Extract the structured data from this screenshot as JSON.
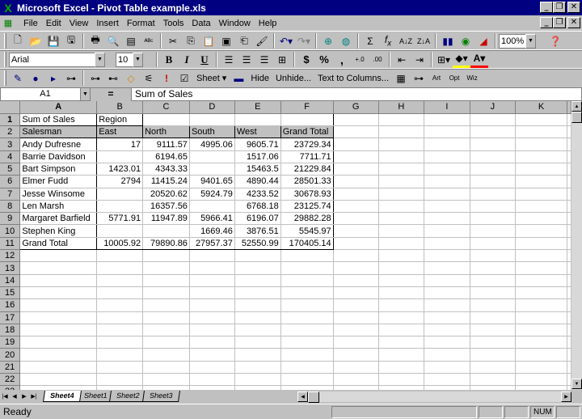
{
  "window": {
    "title": "Microsoft Excel - Pivot Table example.xls",
    "app_icon": "excel-icon"
  },
  "menu": [
    "File",
    "Edit",
    "View",
    "Insert",
    "Format",
    "Tools",
    "Data",
    "Window",
    "Help"
  ],
  "toolbar": {
    "zoom": "100%",
    "font_name": "Arial",
    "font_size": "10",
    "bold_label": "B",
    "italic_label": "I",
    "underline_label": "U",
    "currency_label": "$",
    "percent_label": "%",
    "sum_label": "Σ",
    "function_label": "f",
    "function_sub": "x"
  },
  "toolbar3": {
    "sheet_label": "Sheet",
    "hide_label": "Hide",
    "unhide_label": "Unhide...",
    "text_to_columns_label": "Text to Columns...",
    "art_label": "Art",
    "opt_label": "Opt",
    "wiz_label": "Wiz"
  },
  "formula_bar": {
    "cell_ref": "A1",
    "equals": "=",
    "content": "Sum of Sales"
  },
  "columns": [
    "A",
    "B",
    "C",
    "D",
    "E",
    "F",
    "G",
    "H",
    "I",
    "J",
    "K"
  ],
  "rows": [
    [
      "Sum of Sales",
      "Region",
      "",
      "",
      "",
      "",
      "",
      "",
      "",
      "",
      ""
    ],
    [
      "Salesman",
      "East",
      "North",
      "South",
      "West",
      "Grand Total",
      "",
      "",
      "",
      "",
      ""
    ],
    [
      "Andy Dufresne",
      "17",
      "9111.57",
      "4995.06",
      "9605.71",
      "23729.34",
      "",
      "",
      "",
      "",
      ""
    ],
    [
      "Barrie Davidson",
      "",
      "6194.65",
      "",
      "1517.06",
      "7711.71",
      "",
      "",
      "",
      "",
      ""
    ],
    [
      "Bart Simpson",
      "1423.01",
      "4343.33",
      "",
      "15463.5",
      "21229.84",
      "",
      "",
      "",
      "",
      ""
    ],
    [
      "Elmer Fudd",
      "2794",
      "11415.24",
      "9401.65",
      "4890.44",
      "28501.33",
      "",
      "",
      "",
      "",
      ""
    ],
    [
      "Jesse Winsome",
      "",
      "20520.62",
      "5924.79",
      "4233.52",
      "30678.93",
      "",
      "",
      "",
      "",
      ""
    ],
    [
      "Len Marsh",
      "",
      "16357.56",
      "",
      "6768.18",
      "23125.74",
      "",
      "",
      "",
      "",
      ""
    ],
    [
      "Margaret Barfield",
      "5771.91",
      "11947.89",
      "5966.41",
      "6196.07",
      "29882.28",
      "",
      "",
      "",
      "",
      ""
    ],
    [
      "Stephen King",
      "",
      "",
      "1669.46",
      "3876.51",
      "5545.97",
      "",
      "",
      "",
      "",
      ""
    ],
    [
      "Grand Total",
      "10005.92",
      "79890.86",
      "27957.37",
      "52550.99",
      "170405.14",
      "",
      "",
      "",
      "",
      ""
    ],
    [
      "",
      "",
      "",
      "",
      "",
      "",
      "",
      "",
      "",
      "",
      ""
    ],
    [
      "",
      "",
      "",
      "",
      "",
      "",
      "",
      "",
      "",
      "",
      ""
    ],
    [
      "",
      "",
      "",
      "",
      "",
      "",
      "",
      "",
      "",
      "",
      ""
    ],
    [
      "",
      "",
      "",
      "",
      "",
      "",
      "",
      "",
      "",
      "",
      ""
    ],
    [
      "",
      "",
      "",
      "",
      "",
      "",
      "",
      "",
      "",
      "",
      ""
    ],
    [
      "",
      "",
      "",
      "",
      "",
      "",
      "",
      "",
      "",
      "",
      ""
    ],
    [
      "",
      "",
      "",
      "",
      "",
      "",
      "",
      "",
      "",
      "",
      ""
    ],
    [
      "",
      "",
      "",
      "",
      "",
      "",
      "",
      "",
      "",
      "",
      ""
    ],
    [
      "",
      "",
      "",
      "",
      "",
      "",
      "",
      "",
      "",
      "",
      ""
    ],
    [
      "",
      "",
      "",
      "",
      "",
      "",
      "",
      "",
      "",
      "",
      ""
    ],
    [
      "",
      "",
      "",
      "",
      "",
      "",
      "",
      "",
      "",
      "",
      ""
    ],
    [
      "",
      "",
      "",
      "",
      "",
      "",
      "",
      "",
      "",
      "",
      ""
    ]
  ],
  "sheet_tabs": [
    "Sheet4",
    "Sheet1",
    "Sheet2",
    "Sheet3"
  ],
  "active_tab": "Sheet4",
  "status": {
    "text": "Ready",
    "num": "NUM"
  }
}
